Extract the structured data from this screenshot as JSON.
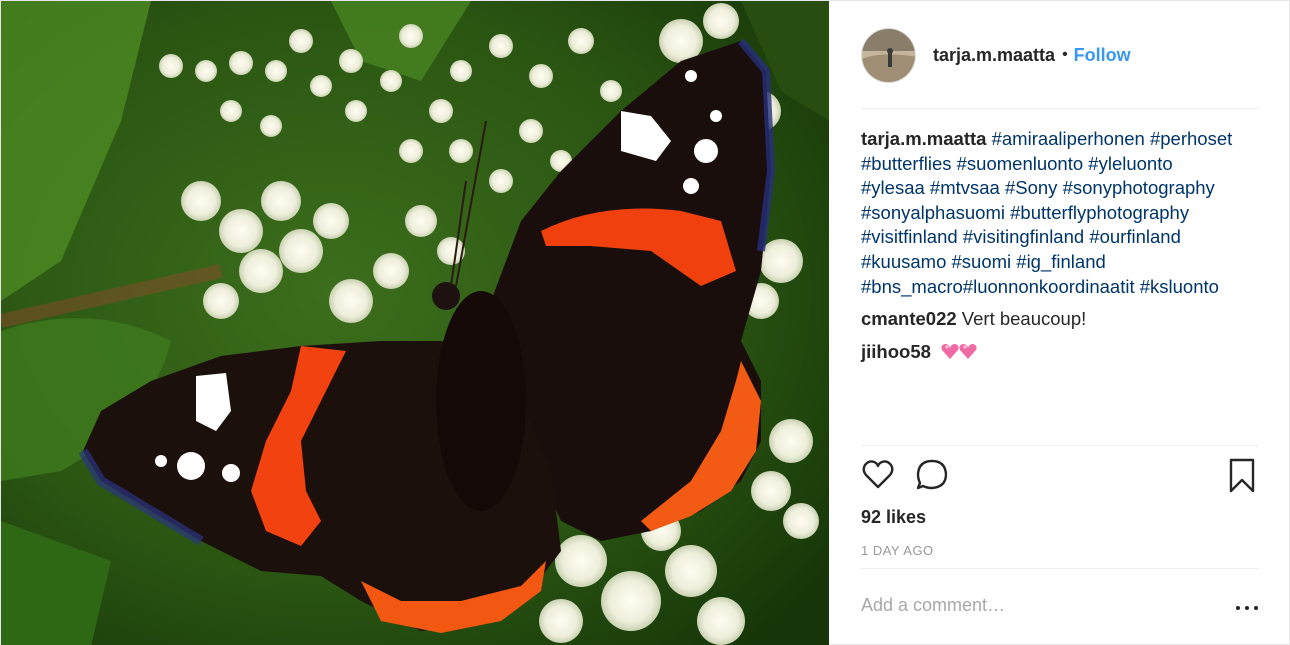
{
  "post": {
    "photo_alt": "",
    "icons": {
      "like": "heart-outline-icon",
      "comment": "speech-bubble-icon",
      "save": "bookmark-icon",
      "more": "ellipsis-icon",
      "hearts": "two-hearts-emoji"
    },
    "accent_color": "#3897f0"
  },
  "header": {
    "username": "tarja.m.maatta",
    "separator": "•",
    "follow_label": "Follow"
  },
  "caption": {
    "author": "tarja.m.maatta",
    "lines": [
      [
        "#amiraaliperhonen",
        "#perhoset"
      ],
      [
        "#butterflies",
        "#suomenluonto",
        "#yleluonto"
      ],
      [
        "#ylesaa",
        "#mtvsaa",
        "#Sony",
        "#sonyphotography"
      ],
      [
        "#sonyalphasuomi",
        "#butterflyphotography"
      ],
      [
        "#visitfinland",
        "#visitingfinland",
        "#ourfinland"
      ],
      [
        "#kuusamo",
        "#suomi",
        "#ig_finland"
      ],
      [
        "#bns_macro#luonnonkoordinaatit",
        "#ksluonto"
      ]
    ]
  },
  "comments": [
    {
      "author": "cmante022",
      "text": "Vert beaucoup!"
    },
    {
      "author": "jiihoo58",
      "text": ""
    }
  ],
  "likes": "92 likes",
  "timestamp": "1 DAY AGO",
  "add_comment": {
    "placeholder": "Add a comment…"
  }
}
